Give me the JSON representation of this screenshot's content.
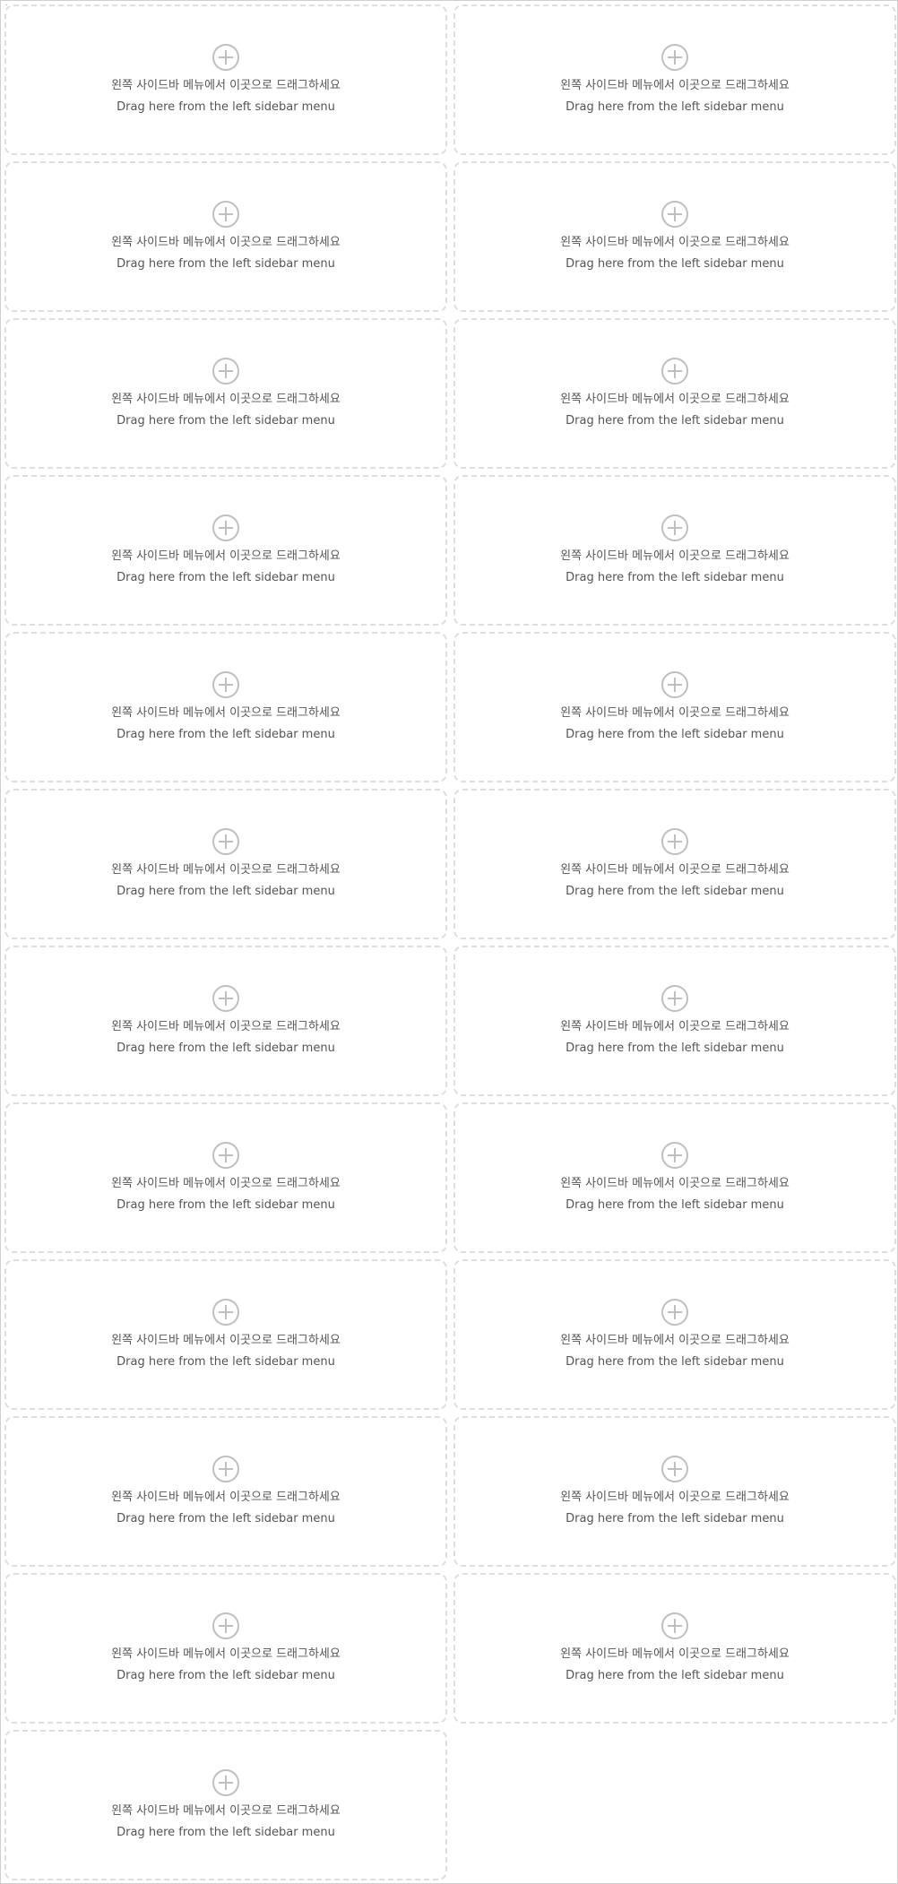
{
  "placeholder": {
    "ko": "왼쪽 사이드바 메뉴에서 이곳으로 드래그하세요",
    "en": "Drag here from the left sidebar menu",
    "icon": "plus-circle-icon"
  },
  "colors": {
    "border": "#dedede",
    "text": "#555555",
    "icon": "#bfbfbf",
    "dots": "#bcbcbc"
  },
  "slot_count": 23
}
